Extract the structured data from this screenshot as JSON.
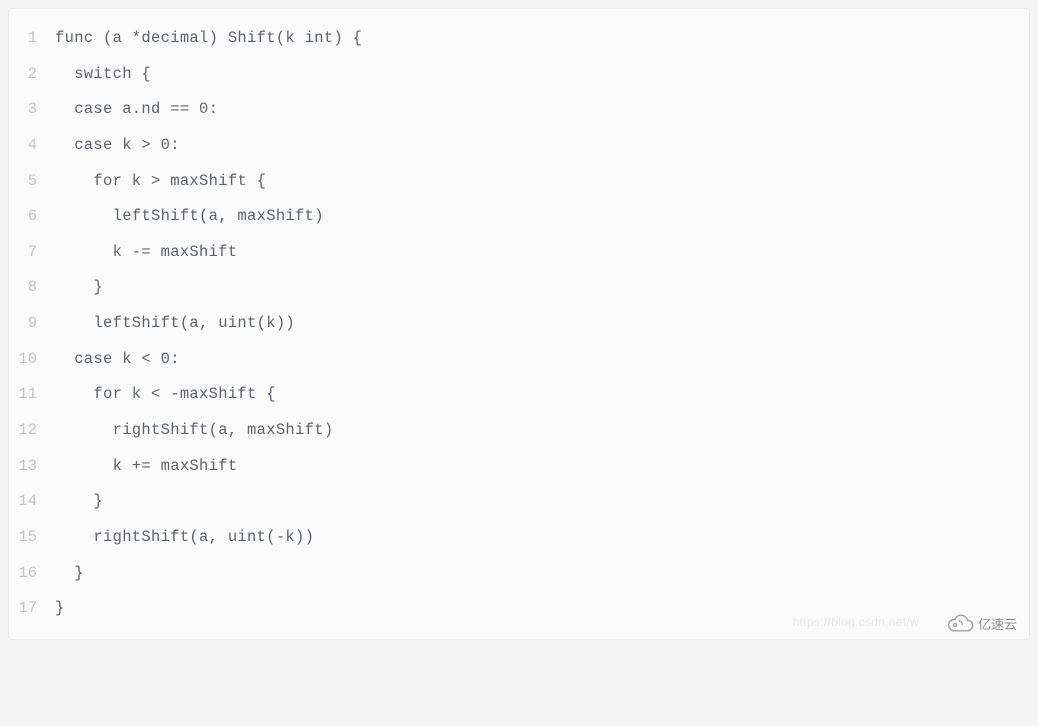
{
  "code": {
    "lines": [
      {
        "n": "1",
        "t": "func (a *decimal) Shift(k int) {"
      },
      {
        "n": "2",
        "t": "  switch {"
      },
      {
        "n": "3",
        "t": "  case a.nd == 0:"
      },
      {
        "n": "4",
        "t": "  case k > 0:"
      },
      {
        "n": "5",
        "t": "    for k > maxShift {"
      },
      {
        "n": "6",
        "t": "      leftShift(a, maxShift)"
      },
      {
        "n": "7",
        "t": "      k -= maxShift"
      },
      {
        "n": "8",
        "t": "    }"
      },
      {
        "n": "9",
        "t": "    leftShift(a, uint(k))"
      },
      {
        "n": "10",
        "t": "  case k < 0:"
      },
      {
        "n": "11",
        "t": "    for k < -maxShift {"
      },
      {
        "n": "12",
        "t": "      rightShift(a, maxShift)"
      },
      {
        "n": "13",
        "t": "      k += maxShift"
      },
      {
        "n": "14",
        "t": "    }"
      },
      {
        "n": "15",
        "t": "    rightShift(a, uint(-k))"
      },
      {
        "n": "16",
        "t": "  }"
      },
      {
        "n": "17",
        "t": "}"
      }
    ]
  },
  "watermark": "https://blog.csdn.net/w",
  "brand": "亿速云"
}
